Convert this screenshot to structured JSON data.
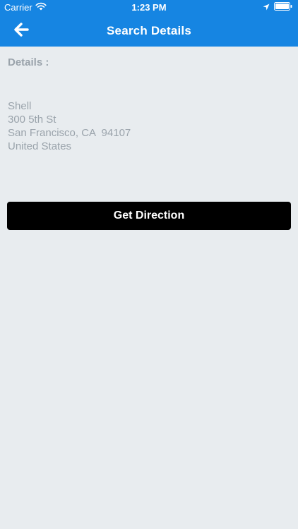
{
  "status_bar": {
    "carrier": "Carrier",
    "time": "1:23 PM"
  },
  "nav": {
    "title": "Search Details"
  },
  "content": {
    "details_label": "Details :",
    "address_lines": [
      "Shell",
      "300 5th St",
      "San Francisco, CA  94107",
      "United States"
    ]
  },
  "actions": {
    "get_direction_label": "Get Direction"
  }
}
